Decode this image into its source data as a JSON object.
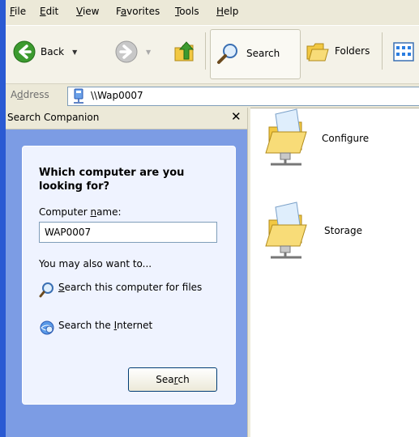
{
  "menu": {
    "items": [
      {
        "name": "file",
        "pre": "",
        "u": "F",
        "post": "ile"
      },
      {
        "name": "edit",
        "pre": "",
        "u": "E",
        "post": "dit"
      },
      {
        "name": "view",
        "pre": "",
        "u": "V",
        "post": "iew"
      },
      {
        "name": "favorites",
        "pre": "F",
        "u": "a",
        "post": "vorites"
      },
      {
        "name": "tools",
        "pre": "",
        "u": "T",
        "post": "ools"
      },
      {
        "name": "help",
        "pre": "",
        "u": "H",
        "post": "elp"
      }
    ]
  },
  "toolbar": {
    "back_label": "Back",
    "search_label": "Search",
    "folders_label": "Folders"
  },
  "address": {
    "label_pre": "A",
    "label_u": "d",
    "label_post": "dress",
    "value": "\\\\Wap0007"
  },
  "search_companion": {
    "title": "Search Companion",
    "close_glyph": "✕",
    "question": "Which computer are you looking for?",
    "computer_name_label_pre": "Computer ",
    "computer_name_label_u": "n",
    "computer_name_label_post": "ame:",
    "computer_name_value": "WAP0007",
    "also_want": "You may also want to...",
    "link1_u": "S",
    "link1_rest": "earch this computer for files",
    "link2_pre": "Search the ",
    "link2_u": "I",
    "link2_post": "nternet",
    "search_button_pre": "Sea",
    "search_button_u": "r",
    "search_button_post": "ch"
  },
  "content": {
    "folders": [
      {
        "name": "Configure"
      },
      {
        "name": "Storage"
      }
    ]
  },
  "colors": {
    "pane_blue": "#7c9ce4",
    "card_bg": "#eff3ff",
    "chrome": "#ece9d8"
  }
}
